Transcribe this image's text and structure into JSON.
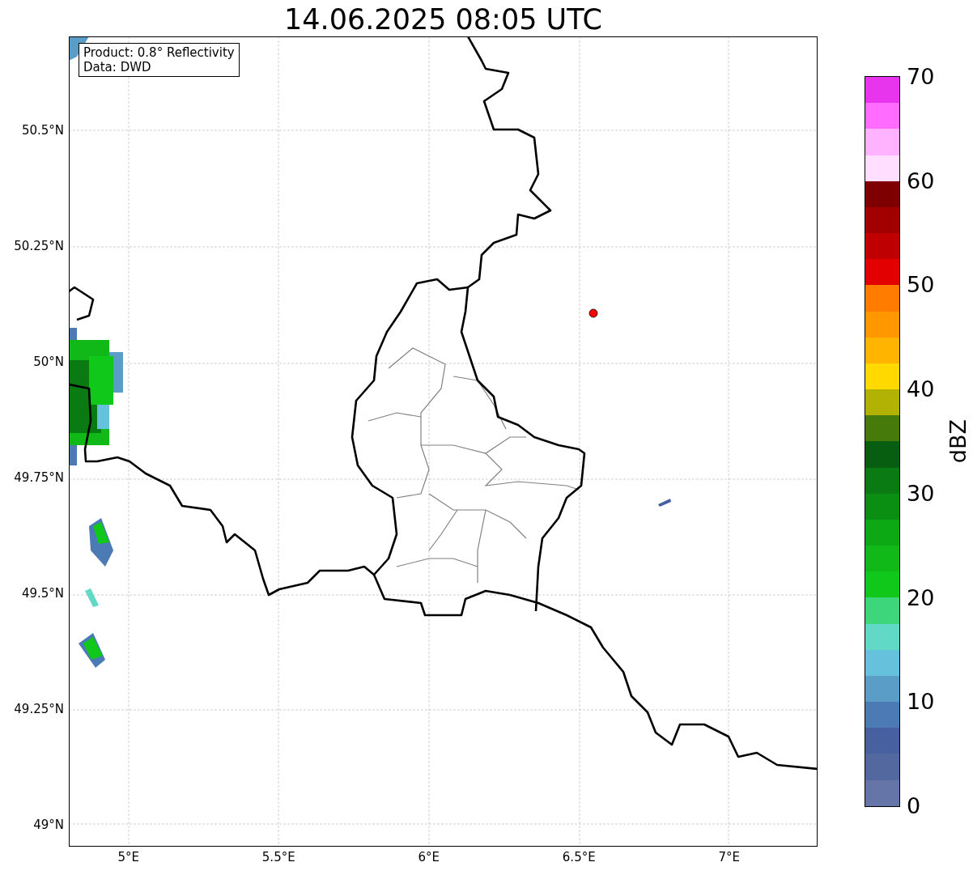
{
  "title": "14.06.2025 08:05 UTC",
  "info_box": {
    "lines": [
      "Product: 0.8° Reflectivity",
      "Data: DWD"
    ]
  },
  "map": {
    "lat_ticks": [
      "50.5°N",
      "50.25°N",
      "50°N",
      "49.75°N",
      "49.5°N",
      "49.25°N",
      "49°N"
    ],
    "lon_ticks": [
      "5°E",
      "5.5°E",
      "6°E",
      "6.5°E",
      "7°E"
    ]
  },
  "colorbar": {
    "label": "dBZ",
    "ticks": [
      "70",
      "60",
      "50",
      "40",
      "30",
      "20",
      "10",
      "0"
    ],
    "bands": [
      {
        "color": "#e834ec"
      },
      {
        "color": "#ff6cff"
      },
      {
        "color": "#ffb2ff"
      },
      {
        "color": "#ffdeff"
      },
      {
        "color": "#7e0000"
      },
      {
        "color": "#a20000"
      },
      {
        "color": "#c00000"
      },
      {
        "color": "#e20000"
      },
      {
        "color": "#ff7c00"
      },
      {
        "color": "#ff9800"
      },
      {
        "color": "#ffb400"
      },
      {
        "color": "#ffd900"
      },
      {
        "color": "#b2b204"
      },
      {
        "color": "#467b0c"
      },
      {
        "color": "#075e10"
      },
      {
        "color": "#0a7a12"
      },
      {
        "color": "#0b8f12"
      },
      {
        "color": "#0ea814"
      },
      {
        "color": "#10b818"
      },
      {
        "color": "#10c81a"
      },
      {
        "color": "#3ed67a"
      },
      {
        "color": "#62d8c6"
      },
      {
        "color": "#66c2dc"
      },
      {
        "color": "#5a9dc6"
      },
      {
        "color": "#4b7ab4"
      },
      {
        "color": "#4660a0"
      },
      {
        "color": "#5468a0"
      },
      {
        "color": "#6575a8"
      }
    ]
  }
}
